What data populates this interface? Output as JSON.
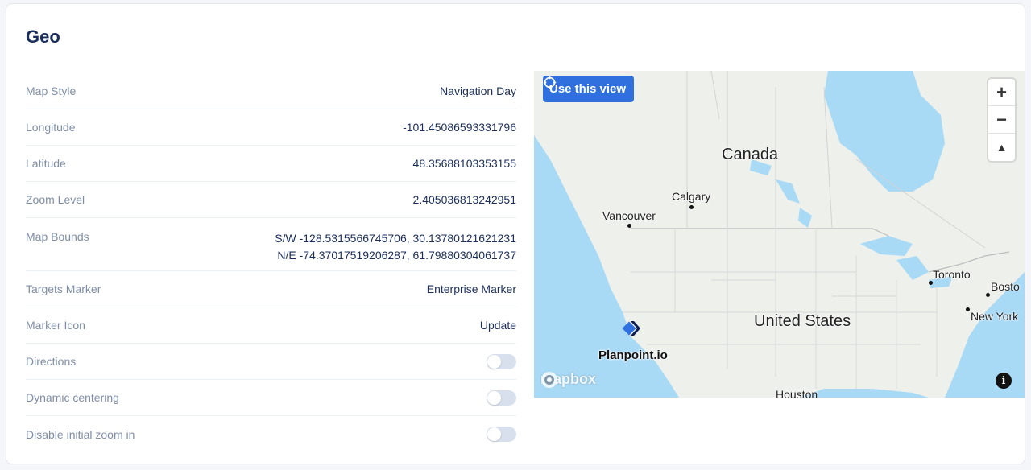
{
  "section": {
    "title": "Geo"
  },
  "properties": [
    {
      "label": "Map Style",
      "value": "Navigation Day"
    },
    {
      "label": "Longitude",
      "value": "-101.45086593331796"
    },
    {
      "label": "Latitude",
      "value": "48.35688103353155"
    },
    {
      "label": "Zoom Level",
      "value": "2.405036813242951"
    }
  ],
  "bounds": {
    "label": "Map Bounds",
    "sw": "S/W -128.5315566745706, 30.13780121621231",
    "ne": "N/E -74.37017519206287, 61.79880304061737"
  },
  "properties2": [
    {
      "label": "Targets Marker",
      "value": "Enterprise Marker"
    },
    {
      "label": "Marker Icon",
      "value": "Update"
    }
  ],
  "toggles": [
    {
      "label": "Directions",
      "on": false
    },
    {
      "label": "Dynamic centering",
      "on": false
    },
    {
      "label": "Disable initial zoom in",
      "on": false
    }
  ],
  "map": {
    "use_view_label": "Use this view",
    "zoom_in": "+",
    "zoom_out": "−",
    "compass": "▲",
    "attribution_logo": "mapbox",
    "info": "i",
    "marker_label": "Planpoint.io",
    "labels": {
      "canada": "Canada",
      "us": "United States",
      "calgary": "Calgary",
      "vancouver": "Vancouver",
      "toronto": "Toronto",
      "boston": "Bosto",
      "newyork": "New York",
      "houston": "Houston"
    },
    "colors": {
      "water": "#a8d9f5",
      "land": "#eef0ec",
      "border": "#c9c9c9",
      "accent": "#2f6fde"
    }
  }
}
